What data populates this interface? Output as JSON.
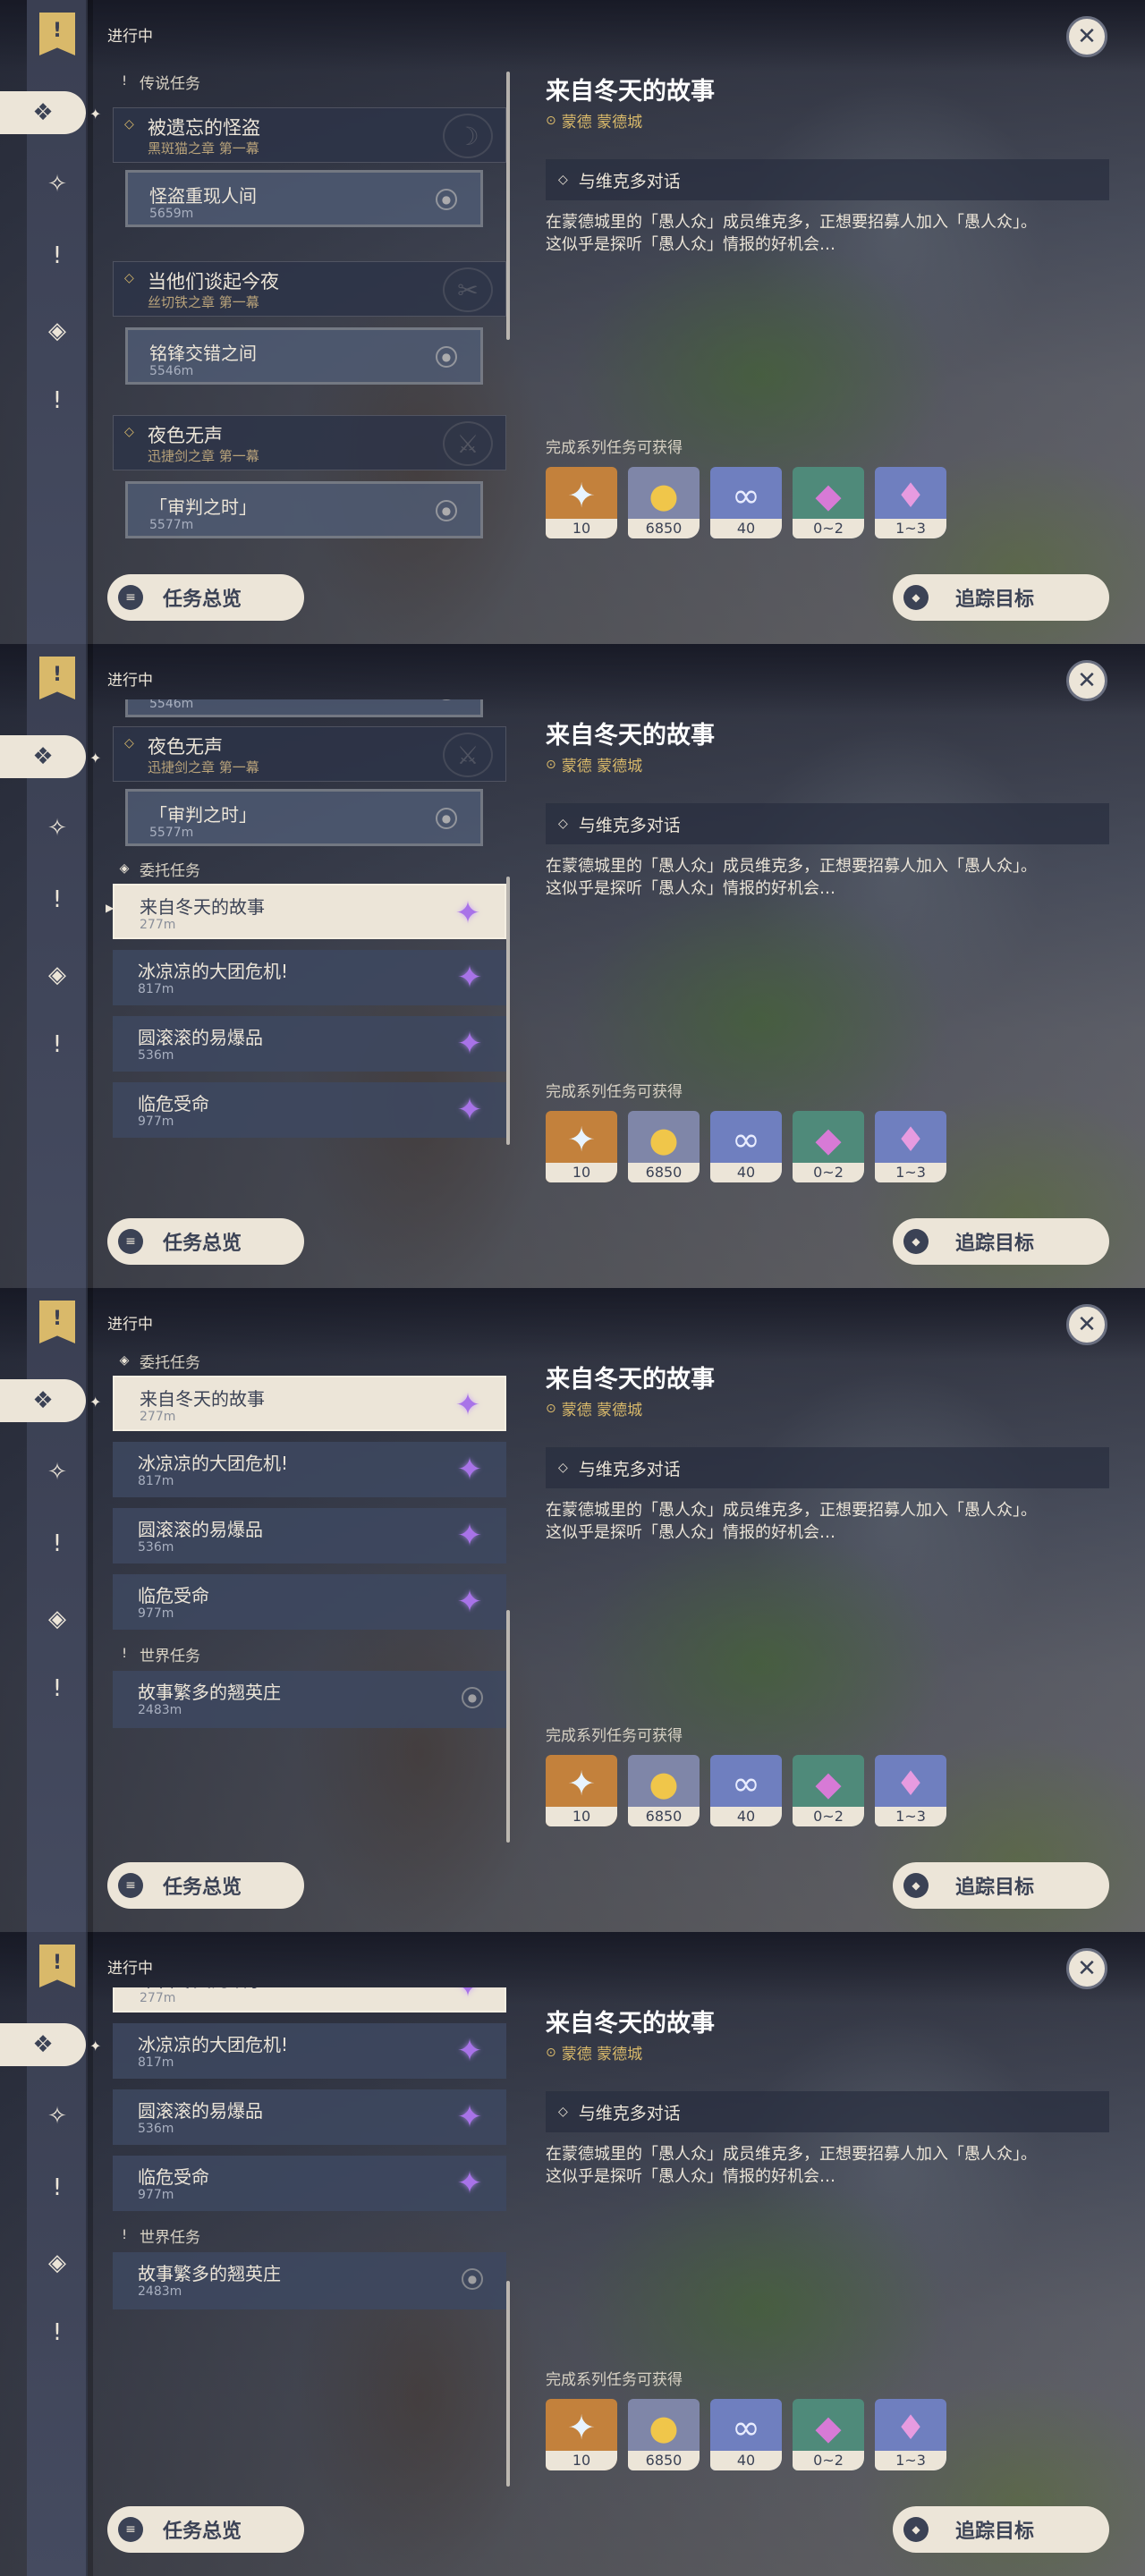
{
  "common": {
    "status_label": "进行中",
    "close_symbol": "✕",
    "overview_button": "任务总览",
    "track_button": "追踪目标"
  },
  "detail": {
    "title": "来自冬天的故事",
    "location": "蒙德 蒙德城",
    "objective": "与维克多对话",
    "description_line1": "在蒙德城里的「愚人众」成员维克多，正想要招募人加入「愚人众」。",
    "description_line2": "这似乎是探听「愚人众」情报的好机会…",
    "rewards_label": "完成系列任务可获得",
    "rewards": [
      {
        "item": "primogem",
        "count": "10",
        "bg": "#c3813c",
        "color": "#e8f4ff"
      },
      {
        "item": "mora",
        "count": "6850",
        "bg": "#7f86a8",
        "color": "#f0c64a"
      },
      {
        "item": "adventure-exp",
        "count": "40",
        "bg": "#6f7fbf",
        "color": "#e8ecff"
      },
      {
        "item": "crystal-chunk",
        "count": "0~2",
        "bg": "#4f8a7a",
        "color": "#d77ad6"
      },
      {
        "item": "crystal-ore",
        "count": "1~3",
        "bg": "#6f7fbf",
        "color": "#e79be0"
      }
    ]
  },
  "quests": {
    "legend_header": "传说任务",
    "commission_header": "委托任务",
    "world_header": "世界任务",
    "legend1": {
      "title": "被遗忘的怪盗",
      "chapter": "黑斑猫之章 第一幕",
      "sub_title": "怪盗重现人间",
      "sub_dist": "5659m"
    },
    "legend2": {
      "title": "当他们谈起今夜",
      "chapter": "丝切铁之章 第一幕",
      "sub_title": "铭锋交错之间",
      "sub_dist": "5546m"
    },
    "legend3": {
      "title": "夜色无声",
      "chapter": "迅捷剑之章 第一幕",
      "sub_title": "「审判之时」",
      "sub_dist": "5577m"
    },
    "legend2_partial_dist": "5546m",
    "commissions": [
      {
        "title": "来自冬天的故事",
        "dist": "277m"
      },
      {
        "title": "冰凉凉的大团危机!",
        "dist": "817m"
      },
      {
        "title": "圆滚滚的易爆品",
        "dist": "536m"
      },
      {
        "title": "临危受命",
        "dist": "977m"
      }
    ],
    "world": {
      "title": "故事繁多的翘英庄",
      "dist": "2483m"
    }
  },
  "colors": {
    "accent_gold": "#d9b96a",
    "panel_light": "#ece5d8",
    "dark_text": "#3b4255",
    "commission_purple": "#a873e8"
  }
}
